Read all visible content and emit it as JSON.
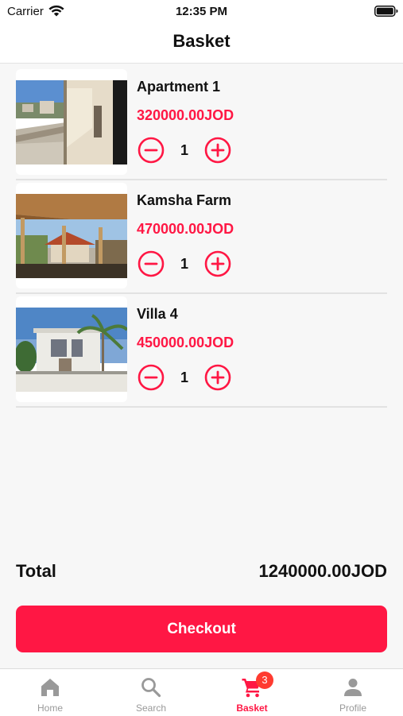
{
  "status_bar": {
    "carrier": "Carrier",
    "time": "12:35 PM"
  },
  "nav": {
    "title": "Basket"
  },
  "items": [
    {
      "name": "Apartment 1",
      "price": "320000.00JOD",
      "quantity": "1"
    },
    {
      "name": "Kamsha Farm",
      "price": "470000.00JOD",
      "quantity": "1"
    },
    {
      "name": "Villa 4",
      "price": "450000.00JOD",
      "quantity": "1"
    }
  ],
  "summary": {
    "total_label": "Total",
    "total_value": "1240000.00JOD"
  },
  "checkout": {
    "label": "Checkout"
  },
  "tabs": [
    {
      "label": "Home",
      "icon": "home-icon"
    },
    {
      "label": "Search",
      "icon": "search-icon"
    },
    {
      "label": "Basket",
      "icon": "cart-icon",
      "badge": "3",
      "active": true
    },
    {
      "label": "Profile",
      "icon": "person-icon"
    }
  ],
  "colors": {
    "accent": "#ff1744",
    "badge": "#ff3b30",
    "inactive_tab": "#999999",
    "background": "#f7f7f7"
  }
}
